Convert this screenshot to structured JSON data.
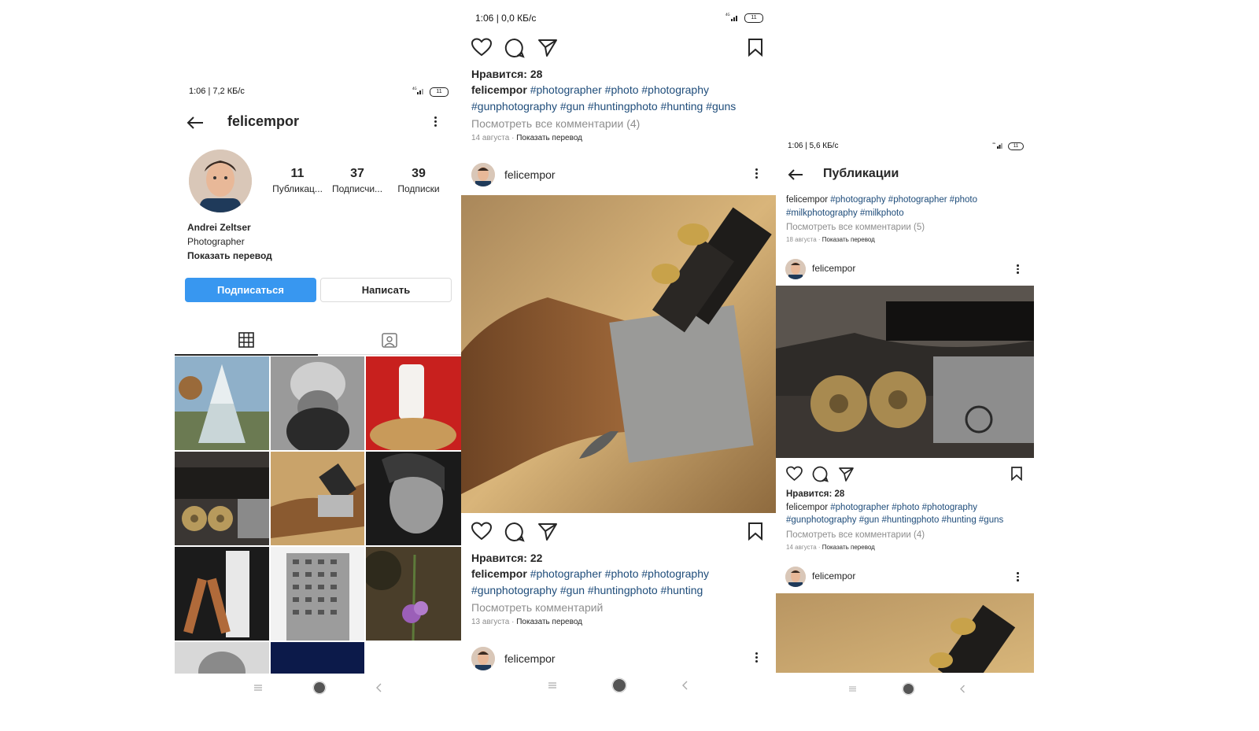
{
  "colors": {
    "accent": "#3897f0",
    "hashtag": "#1e4c7a",
    "muted": "#8e8e8e",
    "text": "#262626"
  },
  "screen1": {
    "status": {
      "time": "1:06 | 7,2 КБ/с",
      "network": "4G",
      "battery": "11"
    },
    "header": {
      "username": "felicempor",
      "back_icon": "arrow-left-icon",
      "menu_icon": "more-vertical-icon"
    },
    "stats": [
      {
        "value": "11",
        "label": "Публикац..."
      },
      {
        "value": "37",
        "label": "Подписчи..."
      },
      {
        "value": "39",
        "label": "Подписки"
      }
    ],
    "bio": {
      "name": "Andrei Zeltser",
      "title": "Photographer",
      "translate": "Показать перевод"
    },
    "buttons": {
      "follow": "Подписаться",
      "message": "Написать"
    },
    "tabs": [
      {
        "icon": "grid-icon",
        "active": true
      },
      {
        "icon": "tagged-person-icon",
        "active": false
      }
    ],
    "grid": [
      "winter-tree-photo",
      "child-hat-photo",
      "milk-glass-photo",
      "shotgun-shells-photo",
      "shotgun-photo",
      "woman-portrait-photo",
      "legs-touring-photo",
      "apartment-building-photo",
      "purple-flower-photo",
      "man-portrait-photo",
      "night-sky-photo"
    ]
  },
  "screen2": {
    "status": {
      "time": "1:06 | 0,0 КБ/с",
      "network": "4G",
      "battery": "11"
    },
    "post_top": {
      "likes": "Нравится: 28",
      "username": "felicempor",
      "caption_line1": "#photographer #photo #photography",
      "caption_line2": "#gunphotography #gun #huntingphoto #hunting #guns",
      "comments": "Посмотреть все комментарии (4)",
      "date": "14 августа",
      "translate": "Показать перевод"
    },
    "post_main": {
      "username": "felicempor",
      "likes": "Нравится: 22",
      "caption_line1": "#photographer #photo #photography",
      "caption_line2": "#gunphotography #gun #huntingphoto #hunting",
      "comments": "Посмотреть комментарий",
      "date": "13 августа",
      "translate": "Показать перевод"
    },
    "post_next": {
      "username": "felicempor"
    }
  },
  "screen3": {
    "status": {
      "time": "1:06 | 5,6 КБ/с",
      "network": "4G",
      "battery": "11"
    },
    "header": {
      "title": "Публикации",
      "back_icon": "arrow-left-icon"
    },
    "post_top": {
      "username": "felicempor",
      "caption_line1": "#photography #photographer #photo",
      "caption_line2": "#milkphotography #milkphoto",
      "comments": "Посмотреть все комментарии (5)",
      "date": "18 августа",
      "translate": "Показать перевод"
    },
    "post_main": {
      "username": "felicempor",
      "likes": "Нравится: 28",
      "caption_line1": "#photographer #photo #photography",
      "caption_line2": "#gunphotography #gun #huntingphoto #hunting #guns",
      "comments": "Посмотреть все комментарии (4)",
      "date": "14 августа",
      "translate": "Показать перевод"
    },
    "post_next": {
      "username": "felicempor"
    }
  },
  "system_nav": {
    "icons": [
      "menu-icon",
      "home-circle-icon",
      "back-chevron-icon"
    ]
  }
}
